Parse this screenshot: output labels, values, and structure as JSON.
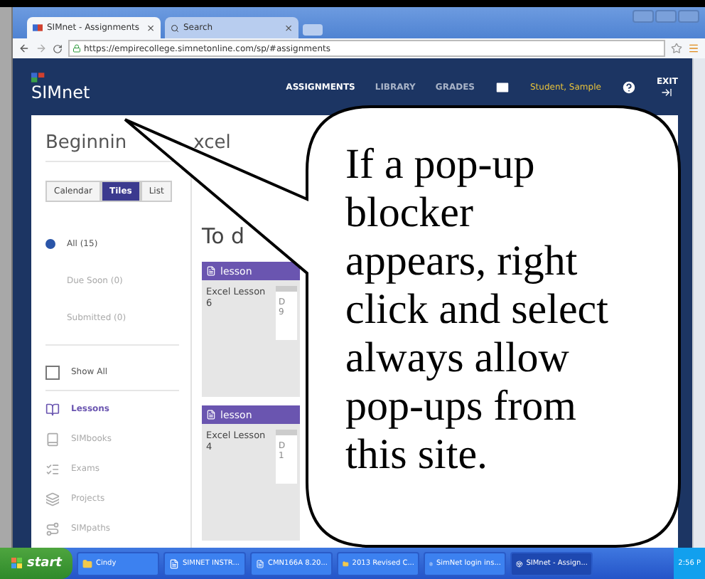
{
  "browser": {
    "tabs": [
      {
        "label": "SIMnet - Assignments",
        "close": "×",
        "selected": true
      },
      {
        "label": "Search",
        "close": "×",
        "selected": false
      }
    ],
    "url": "https://empirecollege.simnetonline.com/sp/#assignments"
  },
  "header": {
    "logo": "SIMnet",
    "nav": [
      {
        "label": "ASSIGNMENTS",
        "selected": true
      },
      {
        "label": "LIBRARY",
        "selected": false
      },
      {
        "label": "GRADES",
        "selected": false
      }
    ],
    "user": "Student, Sample",
    "exit": "EXIT"
  },
  "course_title": [
    "Beginnin",
    "xcel"
  ],
  "views": [
    {
      "label": "Calendar",
      "selected": false
    },
    {
      "label": "Tiles",
      "selected": true
    },
    {
      "label": "List",
      "selected": false
    }
  ],
  "filters": [
    {
      "label": "All (15)",
      "selected": true
    },
    {
      "label": "Due Soon (0)",
      "selected": false
    },
    {
      "label": "Submitted (0)",
      "selected": false
    }
  ],
  "show_all": {
    "label": "Show All",
    "checked": false
  },
  "types": [
    {
      "label": "Lessons",
      "selected": true
    },
    {
      "label": "SIMbooks",
      "selected": false
    },
    {
      "label": "Exams",
      "selected": false
    },
    {
      "label": "Projects",
      "selected": false
    },
    {
      "label": "SIMpaths",
      "selected": false
    }
  ],
  "section_title": "To d",
  "cards": [
    {
      "type": "lesson",
      "title": "Excel Lesson 6",
      "due_label": "D",
      "due_value": "9"
    },
    {
      "type": "lesson",
      "title": "Excel Lesson 4",
      "due_label": "D",
      "due_value": "1"
    }
  ],
  "callout": {
    "text": "If a pop-up blocker appears, right click and select always allow pop-ups from this site."
  },
  "taskbar": {
    "start": "start",
    "items": [
      {
        "label": "Cindy",
        "kind": "folder",
        "selected": false
      },
      {
        "label": "SIMNET INSTR...",
        "kind": "word",
        "selected": false
      },
      {
        "label": "CMN166A 8.20...",
        "kind": "word",
        "selected": false
      },
      {
        "label": "2013 Revised C...",
        "kind": "folder",
        "selected": false
      },
      {
        "label": "SimNet login ins...",
        "kind": "word",
        "selected": false
      },
      {
        "label": "SIMnet - Assign...",
        "kind": "browser",
        "selected": true
      }
    ],
    "time": "2:56 P"
  }
}
